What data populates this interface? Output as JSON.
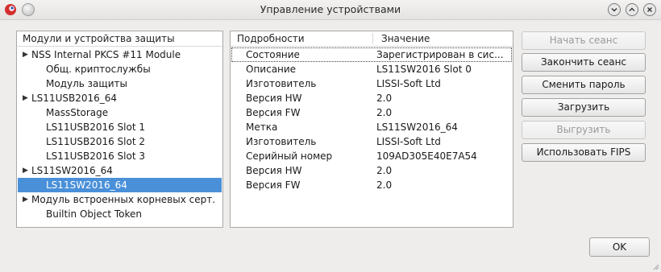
{
  "window": {
    "title": "Управление устройствами"
  },
  "tree": {
    "header": "Модули и устройства защиты",
    "items": [
      {
        "label": "NSS Internal PKCS #11 Module",
        "level": 0,
        "expandable": true,
        "selected": false
      },
      {
        "label": "Общ. криптослужбы",
        "level": 1,
        "expandable": false,
        "selected": false
      },
      {
        "label": "Модуль защиты",
        "level": 1,
        "expandable": false,
        "selected": false
      },
      {
        "label": "LS11USB2016_64",
        "level": 0,
        "expandable": true,
        "selected": false
      },
      {
        "label": "MassStorage",
        "level": 1,
        "expandable": false,
        "selected": false
      },
      {
        "label": "LS11USB2016 Slot 1",
        "level": 1,
        "expandable": false,
        "selected": false
      },
      {
        "label": "LS11USB2016 Slot 2",
        "level": 1,
        "expandable": false,
        "selected": false
      },
      {
        "label": "LS11USB2016 Slot 3",
        "level": 1,
        "expandable": false,
        "selected": false
      },
      {
        "label": "LS11SW2016_64",
        "level": 0,
        "expandable": true,
        "selected": false
      },
      {
        "label": "LS11SW2016_64",
        "level": 1,
        "expandable": false,
        "selected": true
      },
      {
        "label": "Модуль встроенных корневых серт.",
        "level": 0,
        "expandable": true,
        "selected": false
      },
      {
        "label": "Builtin Object Token",
        "level": 1,
        "expandable": false,
        "selected": false
      }
    ]
  },
  "details": {
    "columns": [
      "Подробности",
      "Значение"
    ],
    "rows": [
      {
        "key": "Состояние",
        "value": "Зарегистрирован в сис..."
      },
      {
        "key": "Описание",
        "value": "LS11SW2016 Slot 0"
      },
      {
        "key": "Изготовитель",
        "value": "LISSI-Soft Ltd"
      },
      {
        "key": "Версия HW",
        "value": "2.0"
      },
      {
        "key": "Версия FW",
        "value": "2.0"
      },
      {
        "key": "Метка",
        "value": "LS11SW2016_64"
      },
      {
        "key": "Изготовитель",
        "value": "LISSI-Soft Ltd"
      },
      {
        "key": "Серийный номер",
        "value": "109AD305E40E7A54"
      },
      {
        "key": "Версия HW",
        "value": "2.0"
      },
      {
        "key": "Версия FW",
        "value": "2.0"
      }
    ]
  },
  "buttons": {
    "start_session": "Начать сеанс",
    "end_session": "Закончить сеанс",
    "change_password": "Сменить пароль",
    "load": "Загрузить",
    "unload": "Выгрузить",
    "use_fips": "Использовать FIPS",
    "ok": "OK"
  },
  "colors": {
    "selection": "#4a90d9",
    "window_bg": "#eeedec"
  }
}
